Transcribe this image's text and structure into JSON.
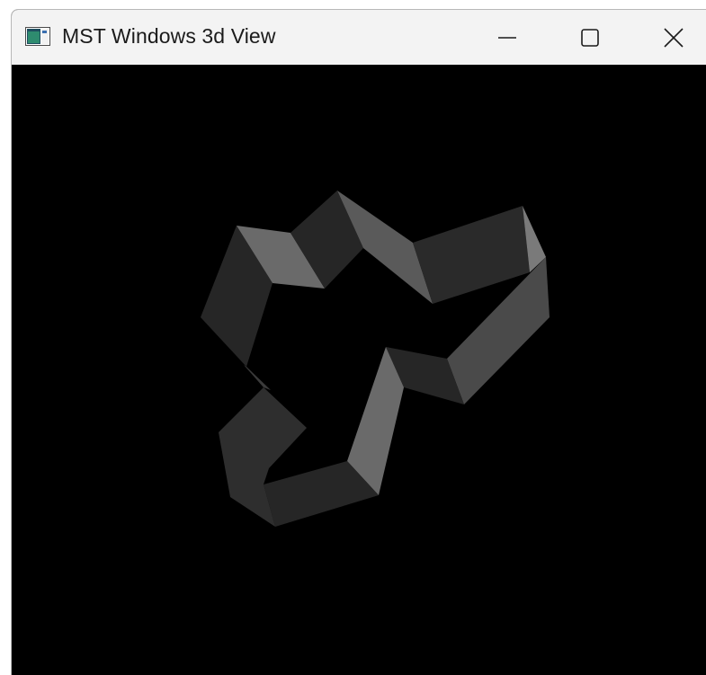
{
  "window": {
    "title": "MST Windows 3d View",
    "app_icon": "window-app-icon",
    "buttons": {
      "minimize": "minimize-icon",
      "maximize": "maximize-icon",
      "close": "close-icon"
    }
  },
  "viewport": {
    "background": "#000000",
    "render": "3d-extruded-tree-path",
    "face_colors": [
      "#1e1e1e",
      "#262626",
      "#2e2e2e",
      "#4a4a4a",
      "#5a5a5a",
      "#6a6a6a"
    ]
  }
}
